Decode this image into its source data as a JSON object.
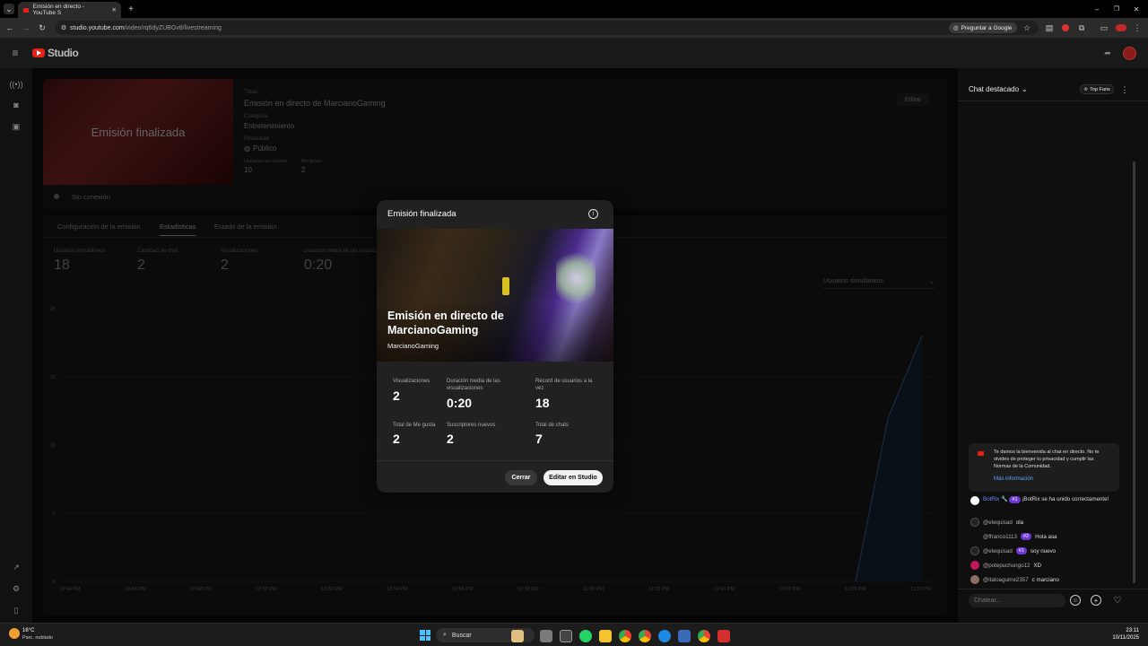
{
  "browser": {
    "tab_title": "Emisión en directo - YouTube S",
    "url_host": "studio.youtube.com",
    "url_path": "/video/rq6dyZUBGv8/livestreaming",
    "ask_google": "Preguntar a Google"
  },
  "studio": {
    "logo": "Studio",
    "video_card": {
      "thumb_text": "Emisión finalizada",
      "title_label": "Título",
      "title_value": "Emisión en directo de MarcianoGaming",
      "category_label": "Categoría",
      "category_value": "Entretenimiento",
      "privacy_label": "Privacidad",
      "privacy_value": "Público",
      "viewers_label": "Usuarios en espera",
      "viewers_value": "10",
      "likes_label": "Me gusta",
      "likes_value": "2",
      "edit_label": "Editar",
      "status": "Sin conexión"
    },
    "tabs": [
      "Configuración de la emisión",
      "Estadísticas",
      "Estado de la emisión"
    ],
    "metrics": [
      {
        "label": "Usuarios simultáneos",
        "value": "18"
      },
      {
        "label": "Cantidad de chat",
        "value": "2"
      },
      {
        "label": "Visualizaciones",
        "value": "2"
      },
      {
        "label": "Duración media de las visualiz",
        "value": "0:20"
      }
    ],
    "chart_selector": "Usuarios simultáneos",
    "y_ticks": [
      "20",
      "15",
      "10",
      "5",
      "0"
    ],
    "x_ticks": [
      "10:44 PM",
      "10:46 PM",
      "10:48 PM",
      "10:50 PM",
      "10:52 PM",
      "10:54 PM",
      "10:56 PM",
      "10:58 PM",
      "11:00 PM",
      "11:02 PM",
      "11:04 PM",
      "11:06 PM",
      "11:08 PM",
      "11:10 PM"
    ]
  },
  "modal": {
    "title": "Emisión finalizada",
    "stream_title": "Emisión en directo de MarcianoGaming",
    "channel": "MarcianoGaming",
    "stats": [
      {
        "label": "Visualizaciones",
        "value": "2"
      },
      {
        "label": "Duración media de las visualizaciones",
        "value": "0:20"
      },
      {
        "label": "Récord de usuarios a la vez",
        "value": "18"
      },
      {
        "label": "Total de Me gusta",
        "value": "2"
      },
      {
        "label": "Suscriptores nuevos",
        "value": "2"
      },
      {
        "label": "Total de chats",
        "value": "7"
      }
    ],
    "close_label": "Cerrar",
    "edit_label": "Editar en Studio"
  },
  "chat": {
    "header": "Chat destacado",
    "top_fans": "Top Fans",
    "welcome": "Te damos la bienvenida al chat en directo. No te olvides de proteger tu privacidad y cumplir las Normas de la Comunidad.",
    "more_info": "Más información",
    "messages": [
      {
        "user": "BotRix 🔧",
        "badge": "#1",
        "text": "¡BotRix se ha unido correctamente!",
        "color": "#6a8cff"
      },
      {
        "user": "@elequisad",
        "badge": "",
        "text": "ola",
        "color": "#aaaaaa"
      },
      {
        "user": "@ffranco1113",
        "badge": "#2",
        "text": "Hola asa",
        "color": "#aaaaaa"
      },
      {
        "user": "@elequisad",
        "badge": "#1",
        "text": "soy nuevo",
        "color": "#aaaaaa"
      },
      {
        "user": "@potepuchungo12",
        "badge": "",
        "text": "XD",
        "color": "#aaaaaa"
      },
      {
        "user": "@italoaguirre2357",
        "badge": "",
        "text": "c marciano",
        "color": "#aaaaaa"
      }
    ],
    "input_placeholder": "Chatear..."
  },
  "taskbar": {
    "weather_temp": "16°C",
    "weather_desc": "Parc. nublado",
    "search": "Buscar",
    "time": "23:11",
    "date": "10/11/2025"
  }
}
